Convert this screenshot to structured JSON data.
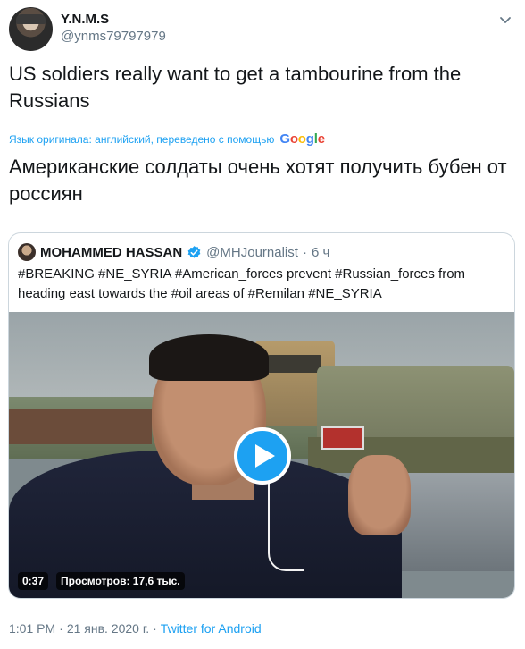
{
  "author": {
    "display_name": "Y.N.M.S",
    "handle": "@ynms79797979"
  },
  "tweet": {
    "text": "US soldiers really want to get a tambourine from the Russians",
    "translation_note": "Язык оригинала: английский, переведено с помощью",
    "translation_provider": "Google",
    "translated_text": "Американские солдаты очень хотят получить бубен от россиян"
  },
  "quoted_tweet": {
    "display_name": "MOHAMMED HASSAN",
    "handle": "@MHJournalist",
    "separator": "·",
    "time_ago": "6 ч",
    "text": "#BREAKING #NE_SYRIA #American_forces prevent #Russian_forces from heading east towards the #oil areas of #Remilan #NE_SYRIA",
    "video": {
      "duration": "0:37",
      "views": "Просмотров: 17,6 тыс."
    }
  },
  "meta": {
    "time": "1:01 PM",
    "separator": "·",
    "date": "21 янв. 2020 г.",
    "source": "Twitter for Android"
  },
  "colors": {
    "accent": "#1da1f2",
    "text_primary": "#14171a",
    "text_secondary": "#657786",
    "border": "#ccd6dd"
  },
  "icons": {
    "caret": "chevron-down-icon",
    "verified": "verified-badge-icon",
    "play": "play-icon"
  }
}
